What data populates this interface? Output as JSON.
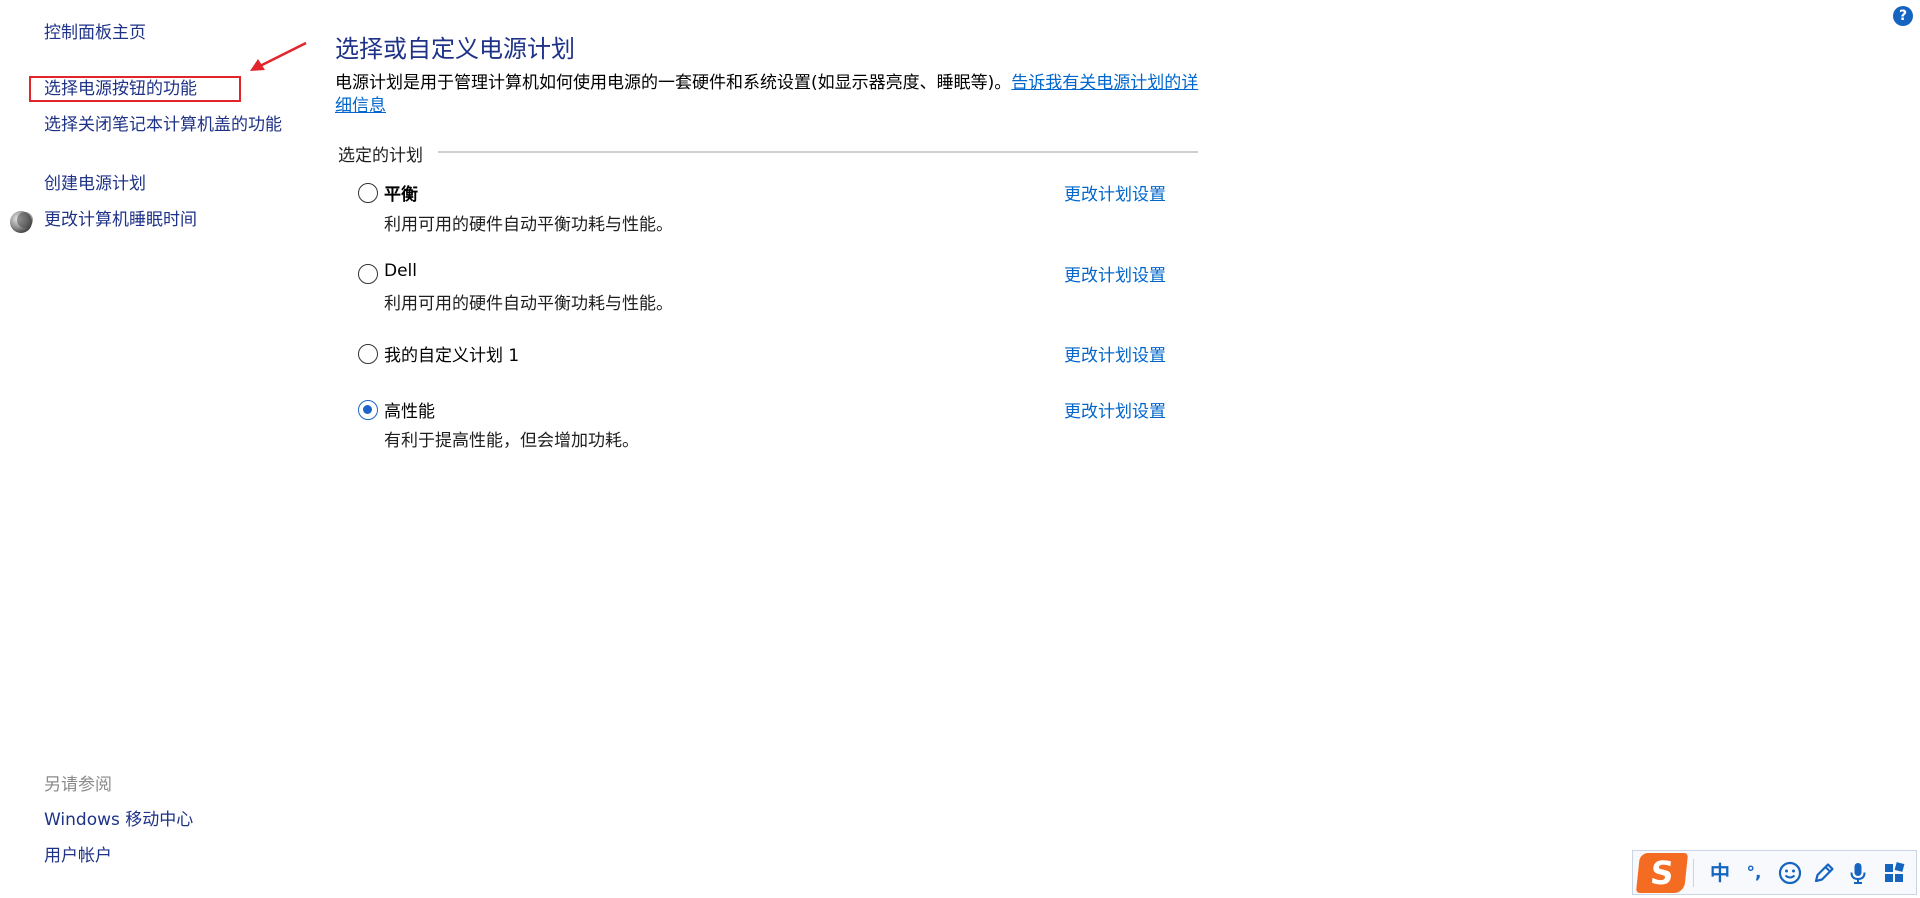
{
  "sidebar": {
    "home_label": "控制面板主页",
    "items": [
      {
        "label": "选择电源按钮的功能"
      },
      {
        "label": "选择关闭笔记本计算机盖的功能"
      },
      {
        "label": "创建电源计划"
      },
      {
        "label": "更改计算机睡眠时间",
        "icon": "moon-icon"
      }
    ],
    "see_also": {
      "heading": "另请参阅",
      "links": [
        {
          "label": "Windows 移动中心"
        },
        {
          "label": "用户帐户"
        }
      ]
    }
  },
  "annotation": {
    "color": "#e0262a",
    "highlighted_item": "选择电源按钮的功能"
  },
  "main": {
    "title": "选择或自定义电源计划",
    "description_text": "电源计划是用于管理计算机如何使用电源的一套硬件和系统设置(如显示器亮度、睡眠等)。",
    "description_link": "告诉我有关电源计划的详细信息",
    "section_heading": "选定的计划",
    "plans": [
      {
        "name": "平衡",
        "description": "利用可用的硬件自动平衡功耗与性能。",
        "selected": false,
        "settings_link": "更改计划设置"
      },
      {
        "name": "Dell",
        "description": "利用可用的硬件自动平衡功耗与性能。",
        "selected": false,
        "settings_link": "更改计划设置"
      },
      {
        "name": "我的自定义计划 1",
        "description": "",
        "selected": false,
        "settings_link": "更改计划设置"
      },
      {
        "name": "高性能",
        "description": "有利于提高性能，但会增加功耗。",
        "selected": true,
        "settings_link": "更改计划设置"
      }
    ]
  },
  "help": {
    "glyph": "?"
  },
  "ime_toolbar": {
    "logo_glyph": "S",
    "mode_label": "中",
    "punct_label": "°,",
    "icons": [
      "emoji-icon",
      "pen-icon",
      "mic-icon",
      "grid-icon"
    ],
    "accent": "#1565c0",
    "logo_color": "#f36c21"
  }
}
